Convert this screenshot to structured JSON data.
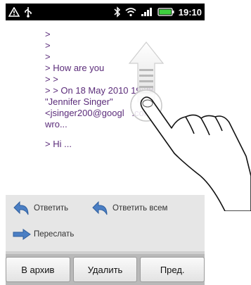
{
  "status_bar": {
    "time": "19:10",
    "icons": [
      "warning-icon",
      "usb-icon",
      "bluetooth-icon",
      "wifi-icon",
      "signal-icon",
      "battery-icon"
    ]
  },
  "email": {
    "quoted_lines": [
      ">",
      ">",
      ">",
      "> How are you",
      "> >",
      "> > On 18 May 2010 19:38,",
      "\"Jennifer Singer\"",
      "<jsinger200@googl   .com>",
      "wro...",
      "",
      "> Hi ..."
    ]
  },
  "actions": {
    "reply": "Ответить",
    "reply_all": "Ответить всем",
    "forward": "Переслать"
  },
  "bottom_buttons": {
    "archive": "В архив",
    "delete": "Удалить",
    "prev": "Пред."
  },
  "colors": {
    "status_bar_bg": "#000000",
    "quote_text": "#5b2c7a",
    "action_panel_bg": "#e6e6e6",
    "reply_arrow": "#4b7fc4"
  }
}
